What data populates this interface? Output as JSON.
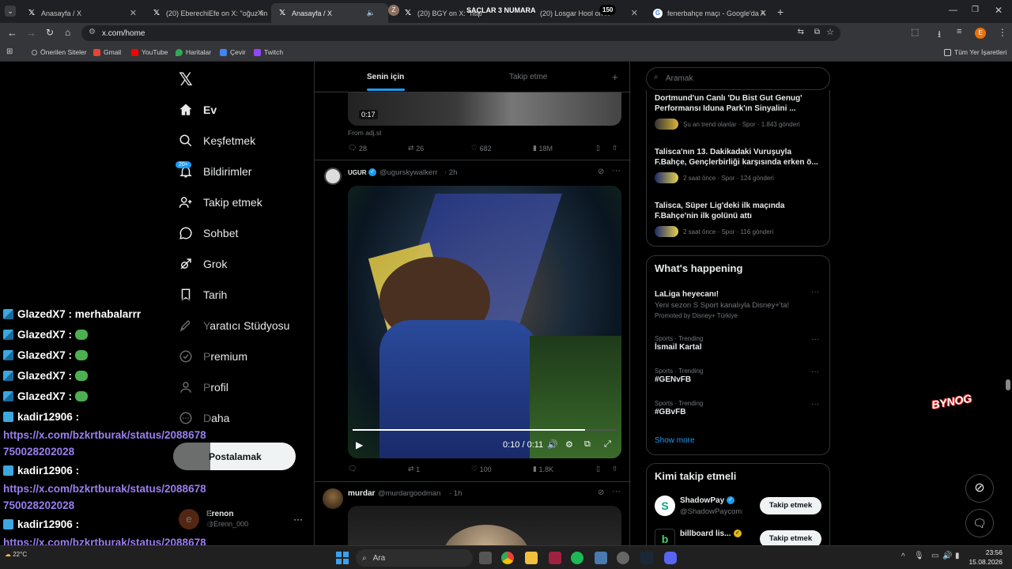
{
  "tabs": [
    {
      "title": "Anasayfa / X"
    },
    {
      "title": "(20) EberechiEfe on X: \"oğuz fin"
    },
    {
      "title": "Anasayfa / X"
    },
    {
      "title": "(20) BGY on X: \"http"
    },
    {
      "title": "(20) Losgar Hool on X"
    },
    {
      "title": "fenerbahçe maçı - Google'da A"
    }
  ],
  "media_overlay": {
    "label": "SAÇLAR 3 NUMARA",
    "count": "150"
  },
  "omnibox": {
    "url": "x.com/home"
  },
  "profile_initial": "E",
  "bookmarks": {
    "items": [
      {
        "label": "Önerilen Siteler"
      },
      {
        "label": "Gmail"
      },
      {
        "label": "YouTube"
      },
      {
        "label": "Haritalar"
      },
      {
        "label": "Çevir"
      },
      {
        "label": "Twitch"
      }
    ],
    "all_label": "Tüm Yer İşaretleri"
  },
  "nav": {
    "items": [
      {
        "label": "Ev"
      },
      {
        "label": "Keşfetmek"
      },
      {
        "label": "Bildirimler"
      },
      {
        "label": "Takip etmek"
      },
      {
        "label": "Sohbet"
      },
      {
        "label": "Grok"
      },
      {
        "label": "Tarih"
      },
      {
        "label": "Yaratıcı Stüdyosu"
      },
      {
        "label": "Premium"
      },
      {
        "label": "Profil"
      },
      {
        "label": "Daha"
      }
    ],
    "notif_badge": "20+",
    "post_button": "Postalamak"
  },
  "account": {
    "name": "Erenon",
    "handle": "@Erenn_000",
    "initial": "e"
  },
  "feed": {
    "tabs": {
      "for_you": "Senin için",
      "following": "Takip etme"
    },
    "post1": {
      "duration": "0:17",
      "source": "From adj.st",
      "replies": "28",
      "reposts": "26",
      "likes": "682",
      "views": "18M"
    },
    "post2": {
      "name": "UGUR",
      "handle": "@ugurskywalkerr",
      "time": "· 2h",
      "video_time": "0:10 / 0:11",
      "replies": "",
      "reposts": "1",
      "likes": "100",
      "views": "1.8K"
    },
    "post3": {
      "name": "murdar",
      "handle": "@murdargoodman",
      "time": "· 1h"
    }
  },
  "search": {
    "placeholder": "Aramak"
  },
  "news": [
    {
      "title": "Dortmund'un Canlı 'Du Bist Gut Genug' Performansı Iduna Park'ın Sinyalini ...",
      "meta": "Şu an trend olanlar · Spor · 1.843 gönderi"
    },
    {
      "title": "Talisca'nın 13. Dakikadaki Vuruşuyla F.Bahçe, Gençlerbirliği karşısında erken ö...",
      "meta": "2 saat önce · Spor · 124 gönderi"
    },
    {
      "title": "Talisca, Süper Lig'deki ilk maçında F.Bahçe'nin ilk golünü attı",
      "meta": "2 saat önce · Spor · 116 gönderi"
    }
  ],
  "whats_happening": {
    "title": "What's happening",
    "promo": {
      "title": "LaLiga heyecanı!",
      "desc": "Yeni sezon S Sport kanalıyla Disney+'ta!",
      "promoted": "Promoted by Disney+ Türkiye"
    },
    "trends": [
      {
        "category": "Sports · Trending",
        "name": "İsmail Kartal"
      },
      {
        "category": "Sports · Trending",
        "name": "#GENvFB"
      },
      {
        "category": "Sports · Trending",
        "name": "#GBvFB"
      }
    ],
    "show_more": "Show more"
  },
  "who_to_follow": {
    "title": "Kimi takip etmeli",
    "accounts": [
      {
        "name": "ShadowPay",
        "handle": "@ShadowPaycom",
        "button": "Takip etmek"
      },
      {
        "name": "billboard lis...",
        "handle": "",
        "button": "Takip etmek"
      }
    ]
  },
  "chat_overlay": {
    "messages": [
      {
        "user": "GlazedX7",
        "text": "merhabalarrr"
      },
      {
        "user": "GlazedX7",
        "text": ""
      },
      {
        "user": "GlazedX7",
        "text": ""
      },
      {
        "user": "GlazedX7",
        "text": ""
      },
      {
        "user": "GlazedX7",
        "text": ""
      },
      {
        "user": "kadir12906",
        "text": "https://x.com/bzkrtburak/status/2088678750028202028"
      },
      {
        "user": "kadir12906",
        "text": "https://x.com/bzkrtburak/status/2088678750028202028"
      },
      {
        "user": "kadir12906",
        "text": "https://x.com/bzkrtburak/status/2088678750028202028"
      }
    ]
  },
  "stream_logo": "BYNOG",
  "taskbar": {
    "search": "Ara",
    "temp": "22°C",
    "time": "23:56",
    "date": "15.08.2026"
  },
  "colors": {
    "accent": "#1d9bf0",
    "chat_link": "#9b7ef0",
    "tab_active": "#35363a"
  }
}
